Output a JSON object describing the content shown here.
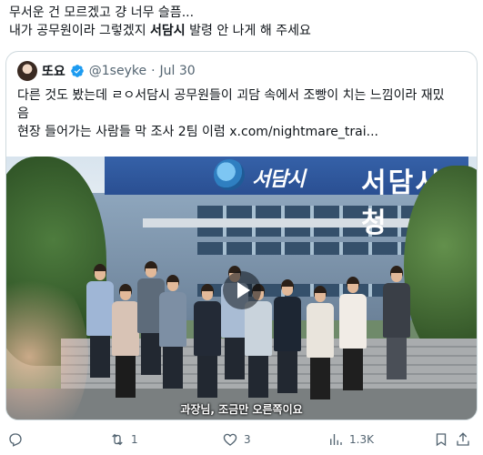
{
  "post": {
    "line1": "무서운 건 모르겠고 걍 너무 슬픔...",
    "line2_prefix": "내가 공무원이라 그렇겠지 ",
    "line2_bold": "서담시",
    "line2_suffix": " 발령 안 나게 해 주세요"
  },
  "quote": {
    "name": "또요",
    "handle": "@1seyke",
    "dot": "·",
    "date": "Jul 30",
    "text_line1": "다른 것도 봤는데 ㄹㅇ서담시 공무원들이 괴담 속에서 조빵이 치는 느낌이라 재밌",
    "text_line2": "음",
    "text_line3": "현장 들어가는 사람들 막 조사 2팀 이럼  x.com/nightmare_trai..."
  },
  "media": {
    "sign_name": "서담시",
    "sign_building": "서담시청",
    "subtitle": "과장님, 조금만 오른쪽이요"
  },
  "actions": {
    "reply_count": "",
    "retweet_count": "1",
    "like_count": "3",
    "views_count": "1.3K"
  },
  "colors": {
    "text": "#0f1419",
    "secondary": "#536471",
    "border": "#cfd9de",
    "verified": "#1d9bf0"
  }
}
